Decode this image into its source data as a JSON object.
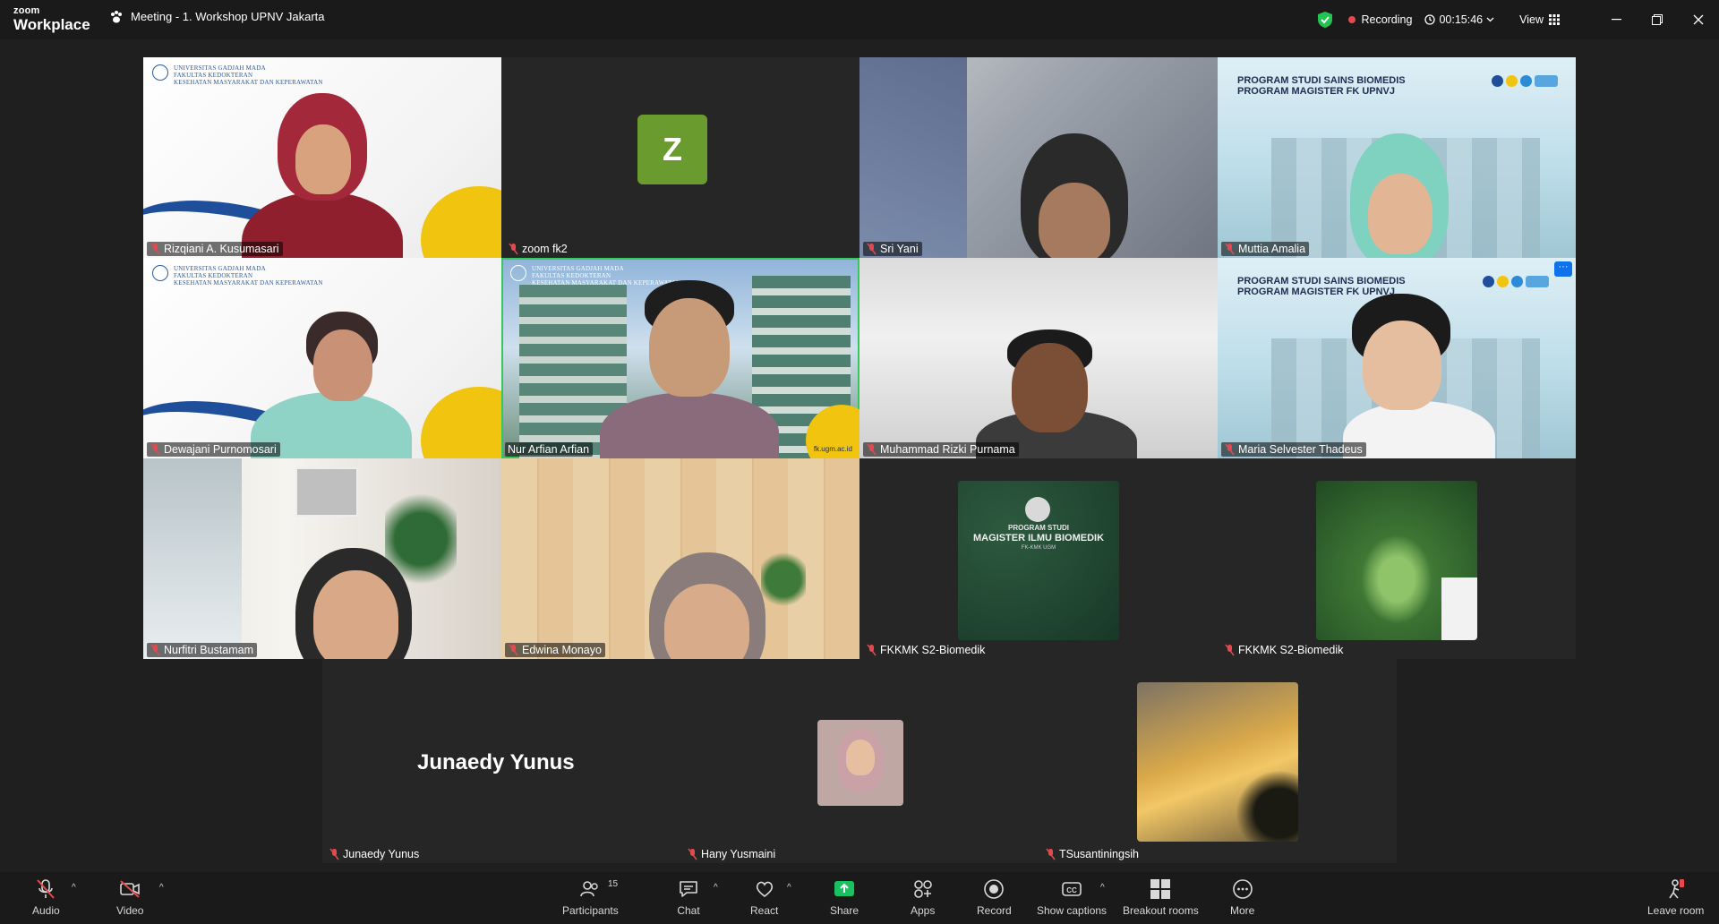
{
  "app": {
    "brand_small": "zoom",
    "brand_large": "Workplace"
  },
  "meeting": {
    "title": "Meeting - 1. Workshop UPNV Jakarta"
  },
  "status": {
    "recording": "Recording",
    "timer": "00:15:46",
    "view": "View"
  },
  "org_labels": {
    "ugm_line1": "UNIVERSITAS GADJAH MADA",
    "ugm_line2": "FAKULTAS KEDOKTERAN",
    "ugm_line3": "KESEHATAN MASYARAKAT DAN KEPERAWATAN",
    "biomed_line1": "PROGRAM STUDI SAINS BIOMEDIS",
    "biomed_line2": "PROGRAM MAGISTER FK UPNVJ",
    "plaque_line1": "PROGRAM STUDI",
    "plaque_line2": "MAGISTER ILMU BIOMEDIK",
    "plaque_line3": "FK-KMK UGM",
    "fk_url": "fk.ugm.ac.id"
  },
  "participants": [
    {
      "name": "Rizqiani A. Kusumasari"
    },
    {
      "name": "zoom fk2",
      "avatar_letter": "Z"
    },
    {
      "name": "Sri Yani"
    },
    {
      "name": "Muttia Amalia"
    },
    {
      "name": "Dewajani Purnomosari"
    },
    {
      "name": "Nur Arfian Arfian"
    },
    {
      "name": "Muhammad Rizki Purnama"
    },
    {
      "name": "Maria Selvester Thadeus"
    },
    {
      "name": "Nurfitri Bustamam"
    },
    {
      "name": "Edwina Monayo"
    },
    {
      "name": "FKKMK S2-Biomedik"
    },
    {
      "name": "FKKMK S2-Biomedik"
    },
    {
      "name": "Junaedy Yunus",
      "display_text": "Junaedy Yunus"
    },
    {
      "name": "Hany Yusmaini"
    },
    {
      "name": "TSusantiningsih"
    }
  ],
  "toolbar": {
    "audio": "Audio",
    "video": "Video",
    "participants": "Participants",
    "participants_count": "15",
    "chat": "Chat",
    "react": "React",
    "share": "Share",
    "apps": "Apps",
    "record": "Record",
    "captions": "Show captions",
    "breakout": "Breakout rooms",
    "more": "More",
    "leave": "Leave room"
  },
  "colors": {
    "active_speaker": "#34c759",
    "share_green": "#19c160",
    "avatar_green": "#6a9b2f",
    "recording_red": "#e5484d"
  }
}
